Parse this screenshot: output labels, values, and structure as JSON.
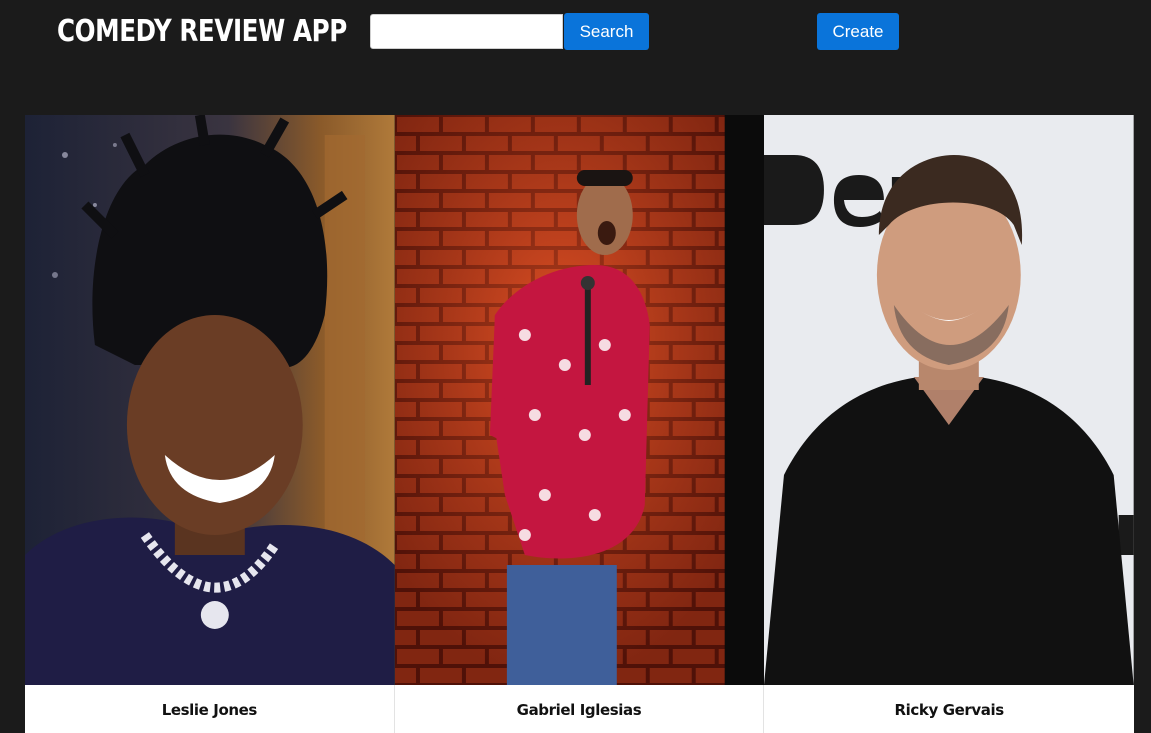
{
  "header": {
    "title": "COMEDY REVIEW APP",
    "search": {
      "value": "",
      "placeholder": ""
    },
    "search_button_label": "Search",
    "create_button_label": "Create"
  },
  "comedians": [
    {
      "name": "Leslie Jones",
      "photo_icon": "comedian-photo-leslie-jones"
    },
    {
      "name": "Gabriel Iglesias",
      "photo_icon": "comedian-photo-gabriel-iglesias"
    },
    {
      "name": "Ricky Gervais",
      "photo_icon": "comedian-photo-ricky-gervais"
    }
  ],
  "colors": {
    "background": "#1b1b1b",
    "accent": "#0a74da",
    "card_caption": "#ffffff"
  }
}
